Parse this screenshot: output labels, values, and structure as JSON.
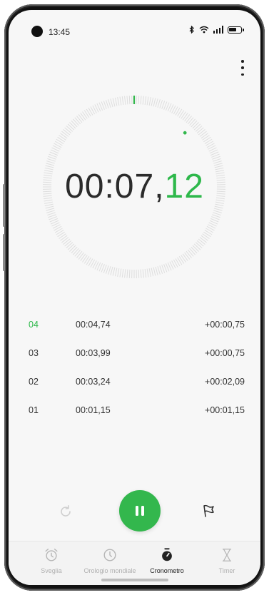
{
  "status": {
    "time": "13:45",
    "battery_level": 0.6
  },
  "menu_icon": "more-vert-icon",
  "stopwatch": {
    "main": "00:07,",
    "hundredths": "12",
    "accent": "#33b74d"
  },
  "laps": [
    {
      "num": "04",
      "time": "00:04,74",
      "diff": "+00:00,75"
    },
    {
      "num": "03",
      "time": "00:03,99",
      "diff": "+00:00,75"
    },
    {
      "num": "02",
      "time": "00:03,24",
      "diff": "+00:02,09"
    },
    {
      "num": "01",
      "time": "00:01,15",
      "diff": "+00:01,15"
    }
  ],
  "controls": {
    "reset_icon": "reset-icon",
    "pause_icon": "pause-icon",
    "lap_icon": "flag-icon"
  },
  "tabs": [
    {
      "label": "Sveglia",
      "icon": "alarm-clock-icon"
    },
    {
      "label": "Orologio mondiale",
      "icon": "world-clock-icon"
    },
    {
      "label": "Cronometro",
      "icon": "stopwatch-icon",
      "active": true
    },
    {
      "label": "Timer",
      "icon": "hourglass-icon"
    }
  ]
}
